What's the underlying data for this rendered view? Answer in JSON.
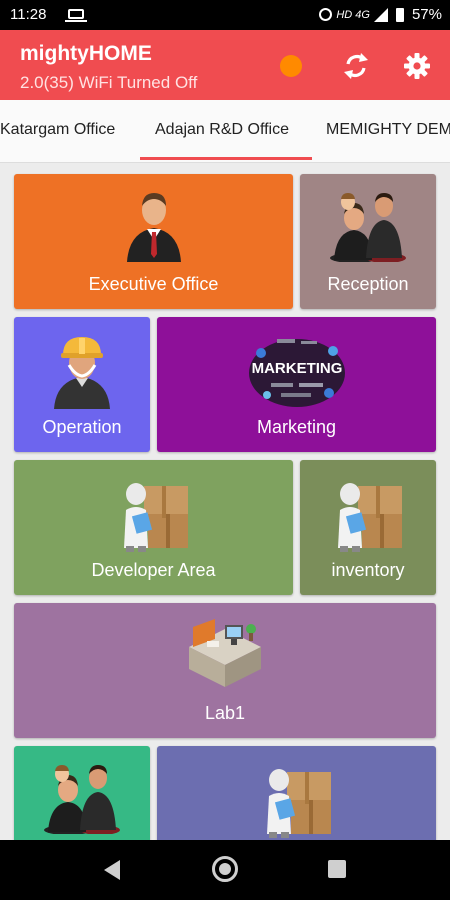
{
  "status_bar": {
    "time": "11:28",
    "network": "HD 4G",
    "battery": "57%"
  },
  "app_bar": {
    "title": "mightyHOME",
    "subtitle": "2.0(35) WiFi Turned Off",
    "status_dot_color": "#ff8a00"
  },
  "tabs": [
    {
      "label": "Katargam Office",
      "selected": false
    },
    {
      "label": "Adajan R&D Office",
      "selected": true
    },
    {
      "label": "MEMIGHTY DEM",
      "selected": false
    }
  ],
  "rooms": [
    {
      "name": "Executive Office",
      "color": "#ee7125",
      "icon": "businessman-icon"
    },
    {
      "name": "Reception",
      "color": "#a08585",
      "icon": "meeting-people-icon"
    },
    {
      "name": "Operation",
      "color": "#6d65ee",
      "icon": "engineer-icon"
    },
    {
      "name": "Marketing",
      "color": "#8e1099",
      "icon": "marketing-word-cloud-icon"
    },
    {
      "name": "Developer Area",
      "color": "#7fa25f",
      "icon": "worker-with-boxes-icon"
    },
    {
      "name": "inventory",
      "color": "#7b8e5a",
      "icon": "worker-with-boxes-icon"
    },
    {
      "name": "Lab1",
      "color": "#9e73a0",
      "icon": "desk-workstation-icon"
    },
    {
      "name": "",
      "color": "#36b985",
      "icon": "meeting-people-icon"
    },
    {
      "name": "",
      "color": "#6c6eb0",
      "icon": "worker-with-boxes-icon"
    }
  ],
  "marketing_image_text": "MARKETING"
}
